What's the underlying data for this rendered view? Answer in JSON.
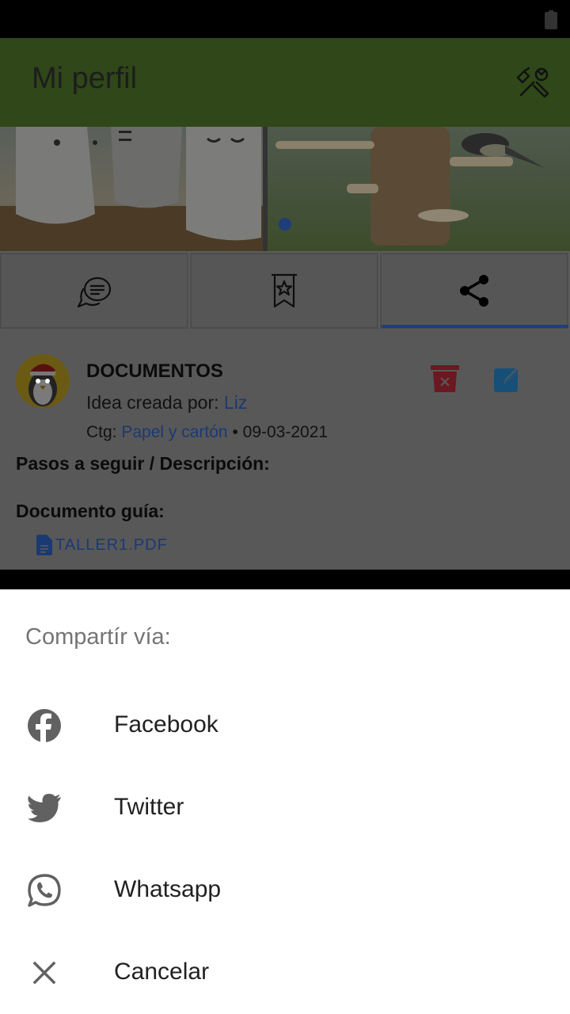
{
  "app_bar": {
    "title": "Mi perfil"
  },
  "card": {
    "title": "DOCUMENTOS",
    "author_prefix": "Idea creada por: ",
    "author_name": "Liz",
    "ctg_prefix": "Ctg: ",
    "ctg_value": "Papel y cartón",
    "date_sep": " • ",
    "date": "09-03-2021",
    "steps_label": "Pasos a seguir / Descripción:",
    "doc_label": "Documento guía:",
    "doc_file": "TALLER1.PDF"
  },
  "share_sheet": {
    "title": "Compartír vía:",
    "options": [
      {
        "label": "Facebook",
        "icon": "facebook-icon"
      },
      {
        "label": "Twitter",
        "icon": "twitter-icon"
      },
      {
        "label": "Whatsapp",
        "icon": "whatsapp-icon"
      },
      {
        "label": "Cancelar",
        "icon": "close-icon"
      }
    ]
  },
  "colors": {
    "app_bar": "#5b8d36",
    "accent_blue": "#2f6bd6",
    "delete_red": "#d9303f",
    "edit_blue": "#2c93d6"
  }
}
